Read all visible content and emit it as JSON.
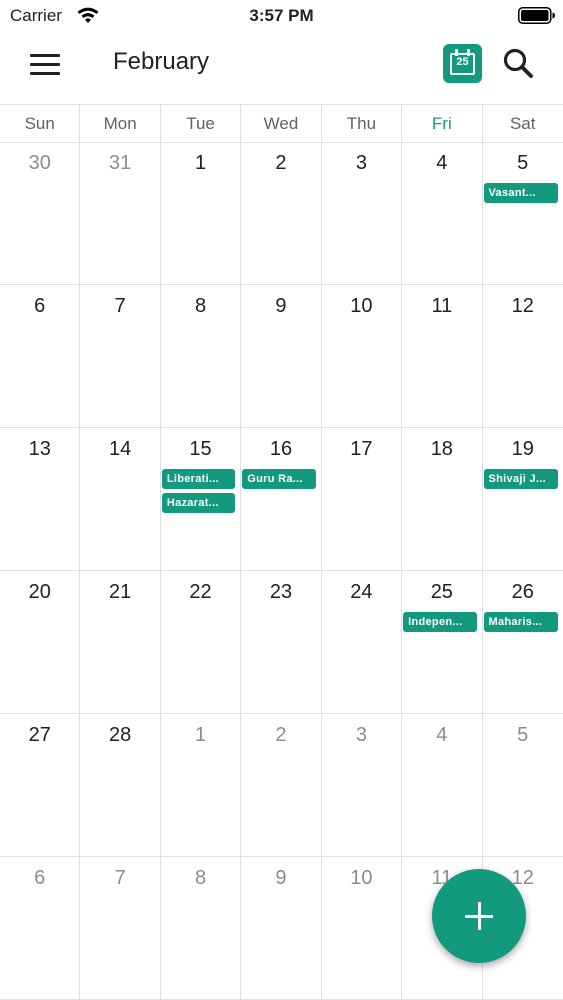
{
  "status_bar": {
    "carrier": "Carrier",
    "time": "3:57 PM"
  },
  "header": {
    "title": "February",
    "today_day": "25"
  },
  "colors": {
    "accent": "#139a7e",
    "text": "#202124",
    "muted": "#8a8d91",
    "grid_line": "#e0e0e0"
  },
  "weekdays": [
    "Sun",
    "Mon",
    "Tue",
    "Wed",
    "Thu",
    "Fri",
    "Sat"
  ],
  "today_weekday_index": 5,
  "weeks": [
    [
      {
        "day": "30",
        "other": true,
        "events": []
      },
      {
        "day": "31",
        "other": true,
        "events": []
      },
      {
        "day": "1",
        "other": false,
        "events": []
      },
      {
        "day": "2",
        "other": false,
        "events": []
      },
      {
        "day": "3",
        "other": false,
        "events": []
      },
      {
        "day": "4",
        "other": false,
        "events": []
      },
      {
        "day": "5",
        "other": false,
        "events": [
          "Vasant..."
        ]
      }
    ],
    [
      {
        "day": "6",
        "other": false,
        "events": []
      },
      {
        "day": "7",
        "other": false,
        "events": []
      },
      {
        "day": "8",
        "other": false,
        "events": []
      },
      {
        "day": "9",
        "other": false,
        "events": []
      },
      {
        "day": "10",
        "other": false,
        "events": []
      },
      {
        "day": "11",
        "other": false,
        "events": []
      },
      {
        "day": "12",
        "other": false,
        "events": []
      }
    ],
    [
      {
        "day": "13",
        "other": false,
        "events": []
      },
      {
        "day": "14",
        "other": false,
        "events": []
      },
      {
        "day": "15",
        "other": false,
        "events": [
          "Liberati...",
          "Hazarat..."
        ]
      },
      {
        "day": "16",
        "other": false,
        "events": [
          "Guru Ra..."
        ]
      },
      {
        "day": "17",
        "other": false,
        "events": []
      },
      {
        "day": "18",
        "other": false,
        "events": []
      },
      {
        "day": "19",
        "other": false,
        "events": [
          "Shivaji J..."
        ]
      }
    ],
    [
      {
        "day": "20",
        "other": false,
        "events": []
      },
      {
        "day": "21",
        "other": false,
        "events": []
      },
      {
        "day": "22",
        "other": false,
        "events": []
      },
      {
        "day": "23",
        "other": false,
        "events": []
      },
      {
        "day": "24",
        "other": false,
        "events": []
      },
      {
        "day": "25",
        "other": false,
        "events": [
          "Indepen..."
        ]
      },
      {
        "day": "26",
        "other": false,
        "events": [
          "Maharis..."
        ]
      }
    ],
    [
      {
        "day": "27",
        "other": false,
        "events": []
      },
      {
        "day": "28",
        "other": false,
        "events": []
      },
      {
        "day": "1",
        "other": true,
        "events": []
      },
      {
        "day": "2",
        "other": true,
        "events": []
      },
      {
        "day": "3",
        "other": true,
        "events": []
      },
      {
        "day": "4",
        "other": true,
        "events": []
      },
      {
        "day": "5",
        "other": true,
        "events": []
      }
    ],
    [
      {
        "day": "6",
        "other": true,
        "events": []
      },
      {
        "day": "7",
        "other": true,
        "events": []
      },
      {
        "day": "8",
        "other": true,
        "events": []
      },
      {
        "day": "9",
        "other": true,
        "events": []
      },
      {
        "day": "10",
        "other": true,
        "events": []
      },
      {
        "day": "11",
        "other": true,
        "events": []
      },
      {
        "day": "12",
        "other": true,
        "events": []
      }
    ]
  ],
  "icons": {
    "menu": "hamburger-menu-icon",
    "today": "calendar-today-icon",
    "search": "search-icon",
    "add": "plus-icon"
  }
}
